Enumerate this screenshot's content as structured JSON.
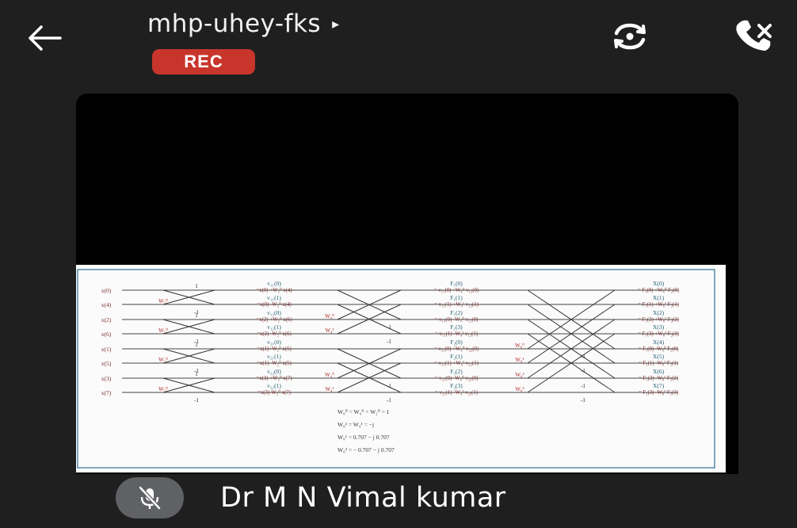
{
  "header": {
    "meeting_code": "mhp-uhey-fks",
    "title_caret": "▸",
    "rec_label": "REC",
    "back_icon": "arrow-left-icon",
    "camera_icon": "switch-camera-icon",
    "call_icon": "call-end-icon"
  },
  "participant": {
    "name": "Dr M N Vimal kumar",
    "mic_icon": "mic-off-icon"
  },
  "slide": {
    "inputs": [
      "x(0)",
      "x(4)",
      "x(2)",
      "x(6)",
      "x(1)",
      "x(5)",
      "x(3)",
      "x(7)"
    ],
    "stage1": [
      "v₁₁(0)",
      "=x(0) +W₂⁰ x(4)",
      "v₁₁(1)",
      "=x(0) -W₂⁰ x(4)",
      "v₁₂(0)",
      "=x(2) +W₂⁰ x(6)",
      "v₁₂(1)",
      "=x(2) -W₂⁰ x(6)",
      "v₂₁(0)",
      "=x(1)+W₂⁰ x(5)",
      "v₂₁(1)",
      "=x(1) -W₂⁰ x(5)",
      "v₂₂(0)",
      "=x(3) +W₂⁰ x(7)",
      "v₂₂(1)",
      "=x(3)-W₂⁰ x(7)"
    ],
    "stage2": [
      "F₁(0)",
      "= v₁₁(0) +W₄⁰ v₁₂(0)",
      "F₁(1)",
      "= v₁₁(1) +W₄¹ v₁₂(1)",
      "F₁(2)",
      "= v₁₁(0) -W₄⁰ v₁₂(0)",
      "F₁(3)",
      "= v₁₁(1) -W₄¹ v₁₂(1)",
      "F₂(0)",
      "= v₂₁(0) +W₄⁰ v₂₂(0)",
      "F₂(1)",
      "= v₂₁(1) +W₄¹ v₂₂(1)",
      "F₂(2)",
      "= v₂₁(0) -W₄⁰ v₂₂(0)",
      "F₂(3)",
      "= v₂₁(1) -W₄¹ v₂₂(1)"
    ],
    "outputs": [
      "X(0)",
      "= F₁(0) +W₈⁰ F₂(0)",
      "X(1)",
      "= F₁(1) +W₈¹ F₂(1)",
      "X(2)",
      "= F₁(2) +W₈² F₂(2)",
      "X(3)",
      "= F₁(3) +W₈³ F₂(3)",
      "X(4)",
      "= F₁(0) -W₈⁰ F₂(0)",
      "X(5)",
      "= F₁(1) -W₈¹ F₂(1)",
      "X(6)",
      "= F₁(2) -W₈² F₂(2)",
      "X(7)",
      "= F₁(3) -W₈³ F₂(3)"
    ],
    "twiddle_w2": "W₂⁰",
    "twiddle_w4_0": "W₄⁰",
    "twiddle_w4_1": "W₄¹",
    "twiddle_w8": [
      "W₈⁰",
      "W₈¹",
      "W₈²",
      "W₈³"
    ],
    "one": "1",
    "minus_one": "-1",
    "formulas": [
      "W₈⁰ = W₄⁰ = W₂⁰ = 1",
      "W₈² = W₄¹ = −j",
      "W₈¹ = 0.707 − j 0.707",
      "W₈³ = − 0.707 − j 0.707"
    ]
  }
}
